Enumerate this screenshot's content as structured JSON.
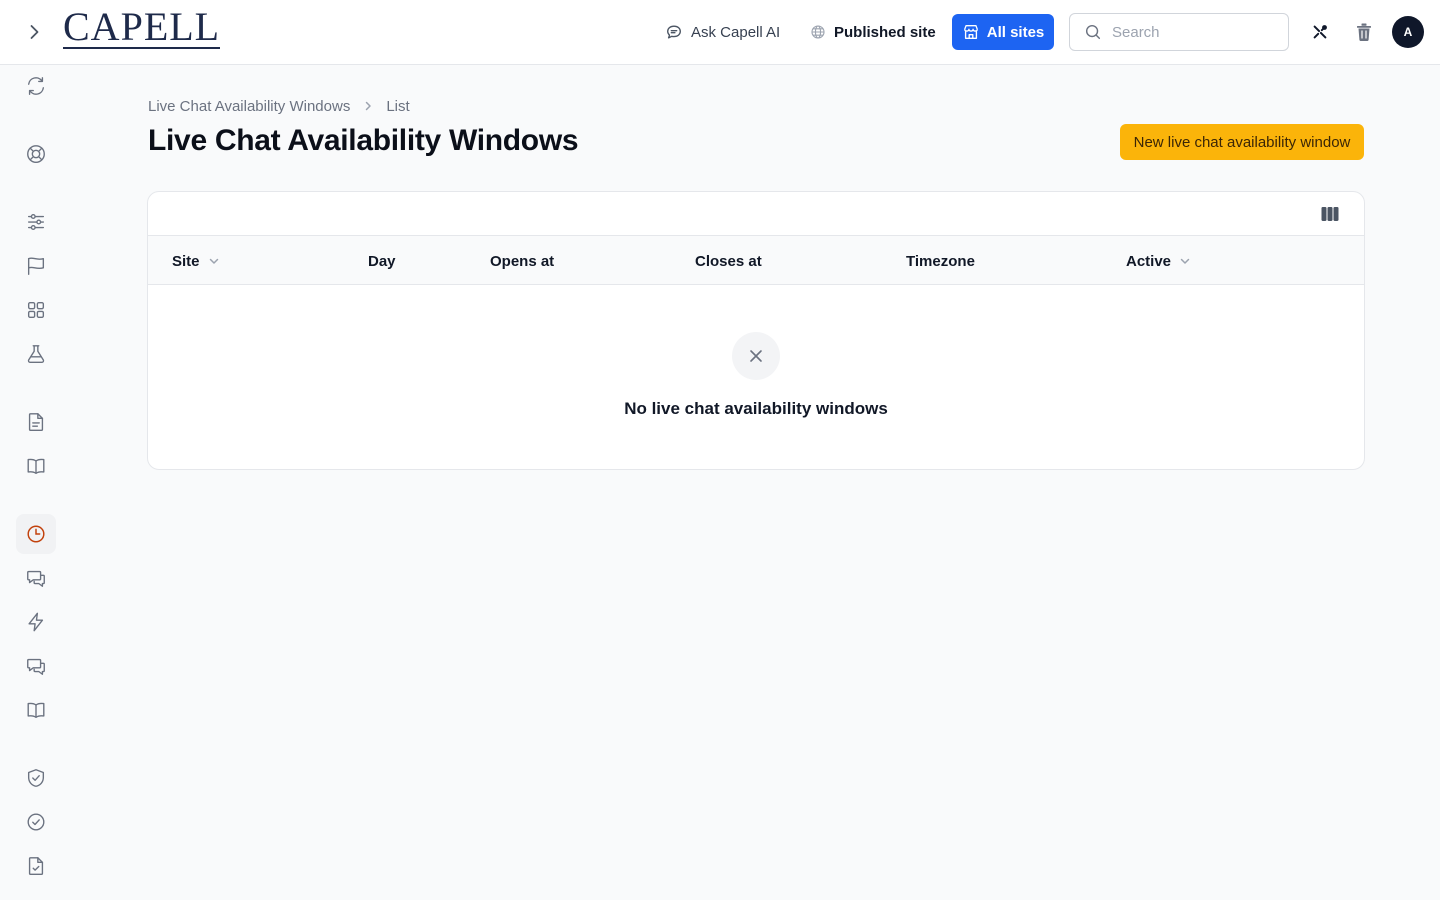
{
  "header": {
    "logo_text": "CAPELL",
    "ask_ai_label": "Ask Capell AI",
    "published_site_label": "Published site",
    "all_sites_label": "All sites",
    "search_placeholder": "Search",
    "search_value": "",
    "avatar_initial": "A",
    "accent_color": "#1d64f2"
  },
  "sidebar": {
    "items": [
      {
        "icon": "refresh-icon",
        "active": false
      },
      {
        "icon": "lifebuoy-icon",
        "active": false
      },
      {
        "icon": "sliders-icon",
        "active": false
      },
      {
        "icon": "flag-icon",
        "active": false
      },
      {
        "icon": "grid-icon",
        "active": false
      },
      {
        "icon": "flask-icon",
        "active": false
      },
      {
        "icon": "document-icon",
        "active": false
      },
      {
        "icon": "book-open-icon",
        "active": false
      },
      {
        "icon": "clock-icon",
        "active": true
      },
      {
        "icon": "chat-bubbles-icon",
        "active": false
      },
      {
        "icon": "bolt-icon",
        "active": false
      },
      {
        "icon": "chat-bubbles-icon",
        "active": false
      },
      {
        "icon": "book-open-icon",
        "active": false
      },
      {
        "icon": "shield-check-icon",
        "active": false
      },
      {
        "icon": "check-circle-icon",
        "active": false
      },
      {
        "icon": "document-check-icon",
        "active": false
      }
    ],
    "active_color": "#c2410c"
  },
  "breadcrumb": {
    "items": [
      "Live Chat Availability Windows",
      "List"
    ]
  },
  "page": {
    "title": "Live Chat Availability Windows",
    "new_button_label": "New live chat availability window",
    "new_button_color": "#fbb40a"
  },
  "table": {
    "columns": [
      {
        "label": "Site",
        "sortable": true
      },
      {
        "label": "Day",
        "sortable": false
      },
      {
        "label": "Opens at",
        "sortable": false
      },
      {
        "label": "Closes at",
        "sortable": false
      },
      {
        "label": "Timezone",
        "sortable": false
      },
      {
        "label": "Active",
        "sortable": true
      }
    ],
    "rows": [],
    "empty_text": "No live chat availability windows"
  }
}
